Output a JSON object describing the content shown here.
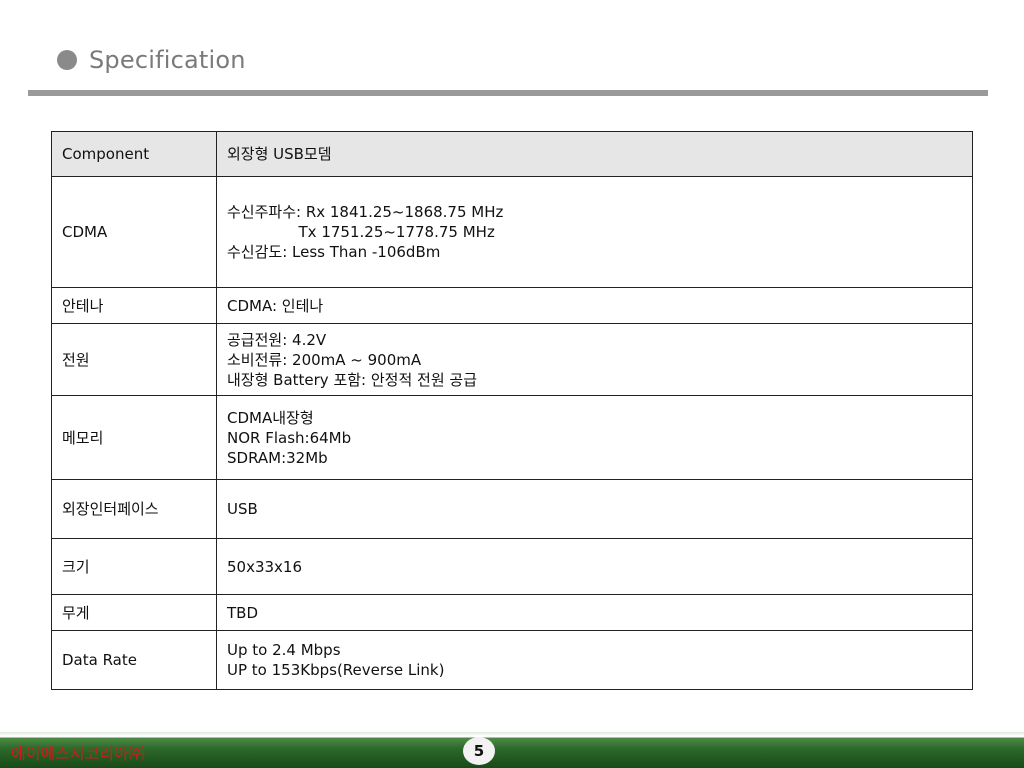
{
  "slide": {
    "title": "Specification"
  },
  "table": {
    "header": {
      "key": "Component",
      "value": "외장형 USB모뎀"
    },
    "rows": [
      {
        "key": "CDMA",
        "lines": [
          "수신주파수: Rx 1841.25~1868.75 MHz",
          "               Tx 1751.25~1778.75 MHz",
          "수신감도: Less Than -106dBm"
        ]
      },
      {
        "key": "안테나",
        "lines": [
          "CDMA: 인테나"
        ]
      },
      {
        "key": "전원",
        "lines": [
          "공급전원: 4.2V",
          "소비전류: 200mA ~ 900mA",
          "내장형 Battery 포함: 안정적 전원 공급"
        ]
      },
      {
        "key": "메모리",
        "lines": [
          "CDMA내장형",
          "NOR Flash:64Mb",
          "SDRAM:32Mb"
        ]
      },
      {
        "key": "외장인터페이스",
        "lines": [
          "USB"
        ]
      },
      {
        "key": "크기",
        "lines": [
          "50x33x16"
        ]
      },
      {
        "key": "무게",
        "lines": [
          "TBD"
        ]
      },
      {
        "key": "Data Rate",
        "lines": [
          "Up to 2.4 Mbps",
          "UP to 153Kbps(Reverse Link)"
        ]
      }
    ]
  },
  "footer": {
    "company": "에이에스지코리아㈜",
    "page_number": "5"
  },
  "colors": {
    "footer_green": "#2e6a2c",
    "company_red": "#d21a1a",
    "title_gray": "#7a7a7a"
  }
}
